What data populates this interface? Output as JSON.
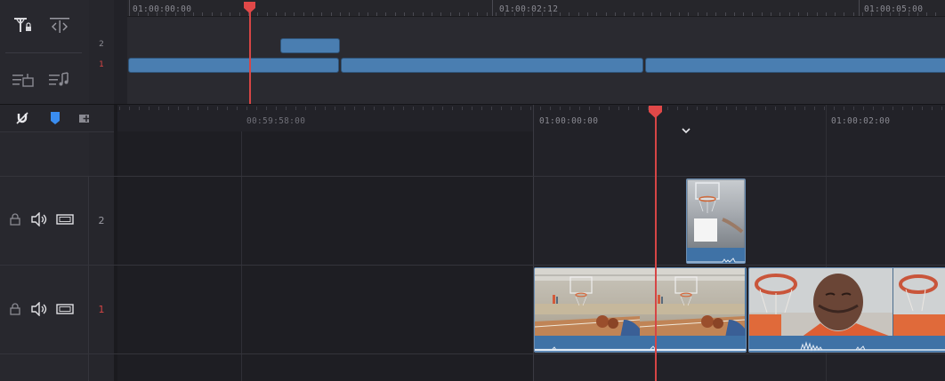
{
  "mini_timeline": {
    "timecodes": [
      "01:00:00:00",
      "01:00:02:12",
      "01:00:05:00"
    ],
    "track_numbers": [
      "2",
      "1"
    ],
    "active_track": "1",
    "tools": [
      "trim-lock-icon",
      "dynamic-trim-icon",
      "insert-audio-icon",
      "audio-track-icon"
    ]
  },
  "toolbar": {
    "icons": [
      "magnet-snap-icon",
      "marker-flag-icon",
      "add-track-icon"
    ]
  },
  "main_timeline": {
    "timecodes": [
      "00:59:58:00",
      "01:00:00:00",
      "01:00:02:00"
    ],
    "tracks": [
      {
        "number": "2",
        "controls": [
          "lock-icon",
          "speaker-icon",
          "monitor-icon"
        ]
      },
      {
        "number": "1",
        "controls": [
          "lock-icon",
          "speaker-icon",
          "monitor-icon"
        ]
      }
    ]
  },
  "colors": {
    "playhead": "#e04848",
    "clip_blue": "#4a7eb1",
    "active_track_number": "#d64545"
  }
}
